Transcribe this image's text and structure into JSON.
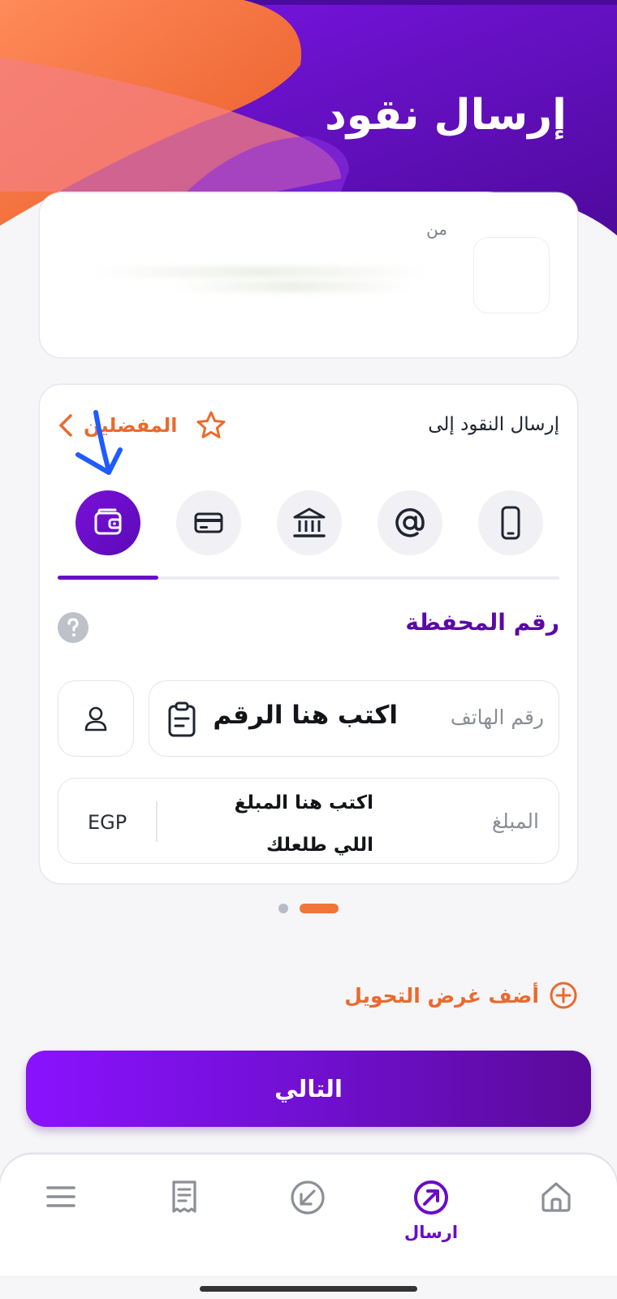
{
  "header": {
    "title": "إرسال نقود"
  },
  "from_card": {
    "label": "من"
  },
  "send_card": {
    "send_to_label": "إرسال النقود إلى",
    "favorites_label": "المفضلين",
    "methods": [
      {
        "name": "mobile",
        "icon": "smartphone-icon"
      },
      {
        "name": "email",
        "icon": "at-sign-icon"
      },
      {
        "name": "bank",
        "icon": "bank-icon"
      },
      {
        "name": "card",
        "icon": "credit-card-icon"
      },
      {
        "name": "wallet",
        "icon": "wallet-icon",
        "selected": true
      }
    ],
    "section_title": "رقم المحفظة",
    "phone_field": {
      "label": "رقم الهاتف",
      "value": "اكتب هنا الرقم"
    },
    "amount_field": {
      "label": "المبلغ",
      "value": "اكتب هنا المبلغ اللي طلعلك",
      "currency": "EGP"
    }
  },
  "pager": {
    "count": 2,
    "active_index": 1
  },
  "purpose_link": "أضف غرض التحويل",
  "next_button": "التالي",
  "bottom_nav": {
    "items": [
      {
        "name": "home",
        "icon": "home-icon",
        "label": ""
      },
      {
        "name": "send",
        "icon": "send-arrow-icon",
        "label": "ارسال",
        "active": true
      },
      {
        "name": "receive",
        "icon": "receive-arrow-icon",
        "label": ""
      },
      {
        "name": "receipts",
        "icon": "receipt-icon",
        "label": ""
      },
      {
        "name": "menu",
        "icon": "menu-icon",
        "label": ""
      }
    ]
  },
  "colors": {
    "primary_purple": "#6a0bc8",
    "accent_orange": "#ea6a2e",
    "annotation_blue": "#1f5bff"
  }
}
